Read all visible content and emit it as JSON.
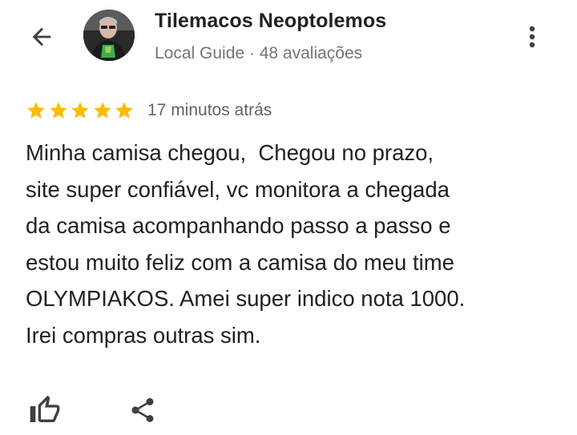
{
  "header": {
    "back_icon": "arrow-back-icon",
    "more_icon": "more-vert-icon"
  },
  "reviewer": {
    "name": "Tilemacos Neoptolemos",
    "meta": "Local Guide · 48 avaliações",
    "avatar": "profile-photo"
  },
  "review": {
    "rating": 5,
    "max_rating": 5,
    "star_color": "#fbbc04",
    "time_ago": "17 minutos atrás",
    "lines": [
      "Minha camisa chegou,  Chegou no prazo,",
      "site super confiável, vc monitora a chegada",
      "da camisa acompanhando passo a passo e",
      "estou muito feliz com a camisa do meu time",
      "OLYMPIAKOS. Amei super indico nota 1000.",
      "Irei compras outras sim."
    ]
  },
  "actions": {
    "like_icon": "thumb-up-icon",
    "share_icon": "share-icon"
  }
}
